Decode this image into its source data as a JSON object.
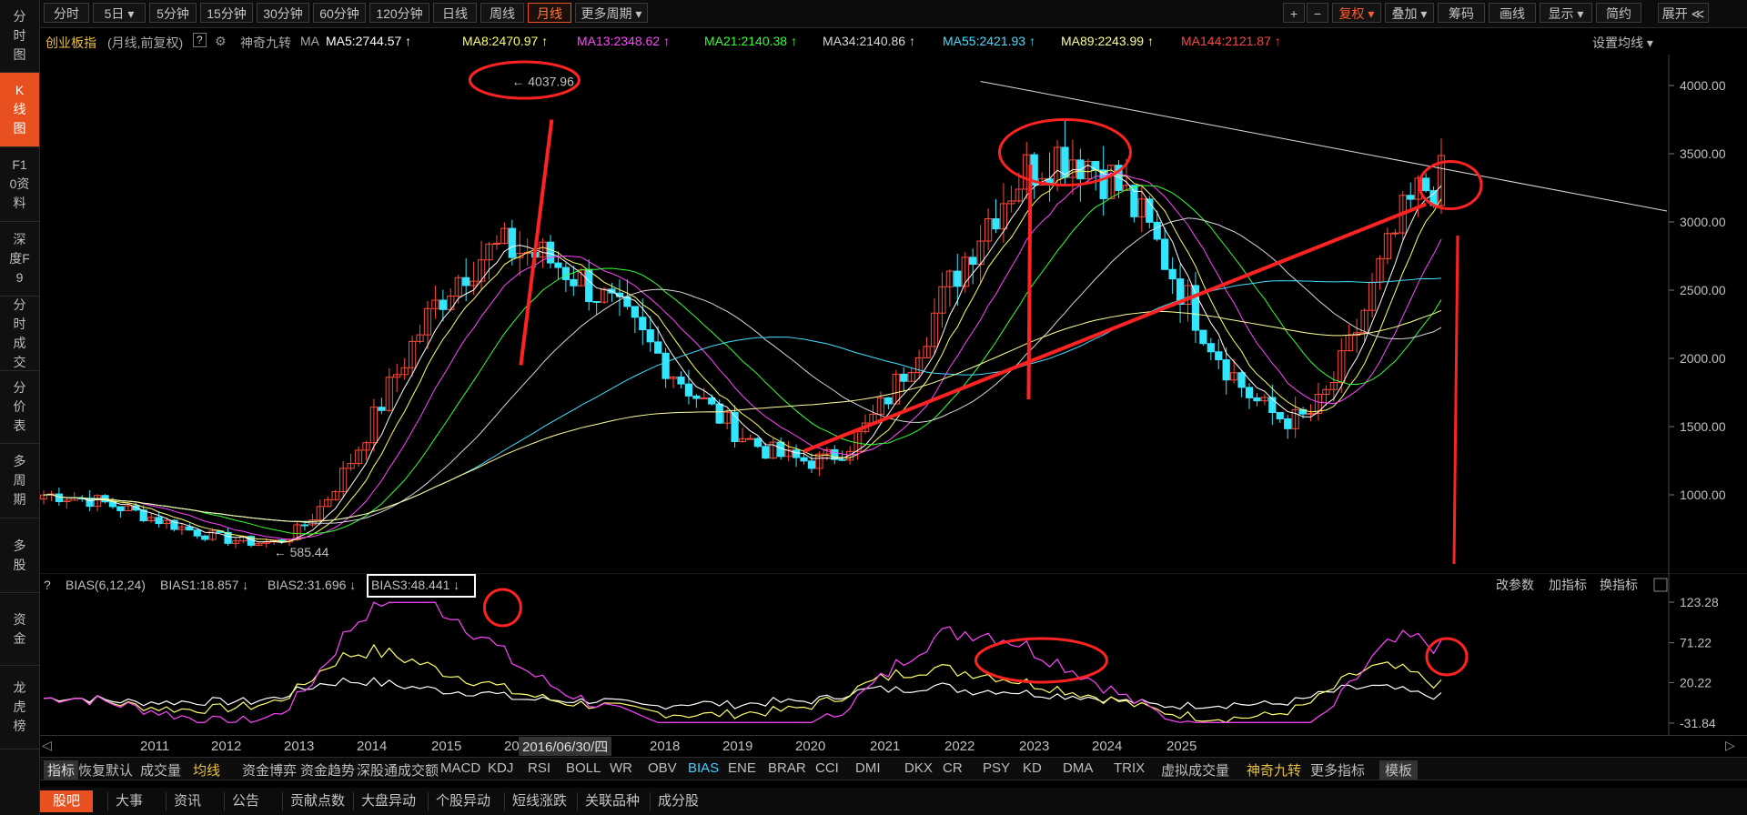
{
  "sidebar": [
    {
      "label": "分时图",
      "active": false
    },
    {
      "label": "K线图",
      "active": true
    },
    {
      "label": "F10资料",
      "active": false
    },
    {
      "label": "深度F9",
      "active": false
    },
    {
      "label": "分时成交",
      "active": false
    },
    {
      "label": "分价表",
      "active": false
    },
    {
      "label": "多周期",
      "active": false
    },
    {
      "label": "多股",
      "active": false
    },
    {
      "label": "资金",
      "active": false
    },
    {
      "label": "龙虎榜",
      "active": false
    }
  ],
  "toolbar": {
    "left": [
      "分时",
      "5日 ▾",
      "5分钟",
      "15分钟",
      "30分钟",
      "60分钟",
      "120分钟",
      "日线",
      "周线",
      "月线",
      "更多周期 ▾"
    ],
    "active": "月线",
    "right": [
      "+",
      "−",
      "复权 ▾",
      "叠加 ▾",
      "筹码",
      "画线",
      "显示 ▾",
      "简约",
      "展开 ≪"
    ]
  },
  "infobar": {
    "name": "创业板指",
    "mode": "(月线,前复权)",
    "help": "?",
    "plugin": "神奇九转",
    "ma_label": "MA",
    "ma_items": [
      {
        "text": "MA5:2744.57",
        "color": "#ffffff"
      },
      {
        "text": "MA8:2470.97",
        "color": "#ffff66"
      },
      {
        "text": "MA13:2348.62",
        "color": "#ff44ff"
      },
      {
        "text": "MA21:2140.38",
        "color": "#33ff33"
      },
      {
        "text": "MA34:2140.86",
        "color": "#d8d8d8"
      },
      {
        "text": "MA55:2421.93",
        "color": "#44ddff"
      },
      {
        "text": "MA89:2243.99",
        "color": "#ffff99"
      },
      {
        "text": "MA144:2121.87",
        "color": "#ff4444"
      }
    ],
    "settings": "设置均线 ▾"
  },
  "chart_data": {
    "type": "candlestick",
    "period": "monthly",
    "y_ticks": [
      4000,
      3500,
      3000,
      2500,
      2000,
      1500,
      1000
    ],
    "y_tick_labels": [
      "4000.00",
      "3500.00",
      "3000.00",
      "2500.00",
      "2000.00",
      "1500.00",
      "1000.00"
    ],
    "x_tick_labels": [
      "2011",
      "2012",
      "2013",
      "2014",
      "2015",
      "2016",
      "2018",
      "2019",
      "2020",
      "2021",
      "2022",
      "2023",
      "2024",
      "2025"
    ],
    "x_cursor_label": "2016/06/30/四",
    "annotations": {
      "high": "4037.96",
      "low": "585.44"
    },
    "key_points": [
      {
        "date": "2010-06",
        "close": 1000
      },
      {
        "date": "2012-11",
        "low": 585.44,
        "close": 650
      },
      {
        "date": "2015-06",
        "high": 4037.96,
        "close": 2800
      },
      {
        "date": "2018-10",
        "close": 1250
      },
      {
        "date": "2021-07",
        "close": 3500
      },
      {
        "date": "2024-01",
        "close": 1550
      },
      {
        "date": "2025-08",
        "close": 3300
      }
    ],
    "bias": {
      "title": "BIAS(6,12,24)",
      "series": [
        {
          "name": "BIAS1",
          "value": "BIAS1:18.857",
          "color": "#ffffff"
        },
        {
          "name": "BIAS2",
          "value": "BIAS2:31.696",
          "color": "#ffff66"
        },
        {
          "name": "BIAS3",
          "value": "BIAS3:48.441",
          "color": "#ff44ff"
        }
      ],
      "y_tick_labels": [
        "123.28",
        "71.22",
        "20.22",
        "-31.84"
      ],
      "y_ticks": [
        123.28,
        71.22,
        20.22,
        -31.84
      ],
      "actions": [
        "改参数",
        "加指标",
        "换指标"
      ]
    }
  },
  "indicators": {
    "items": [
      "指标",
      "恢复默认",
      "成交量",
      "均线",
      "资金博弈",
      "资金趋势",
      "深股通成交额",
      "MACD",
      "KDJ",
      "RSI",
      "BOLL",
      "WR",
      "OBV",
      "BIAS",
      "ENE",
      "BRAR",
      "CCI",
      "DMI",
      "DKX",
      "CR",
      "PSY",
      "KD",
      "DMA",
      "TRIX",
      "虚拟成交量",
      "神奇九转",
      "更多指标",
      "模板"
    ],
    "active": "BIAS"
  },
  "bottom": {
    "items": [
      "股吧",
      "大事",
      "资讯",
      "公告",
      "贡献点数",
      "大盘异动",
      "个股异动",
      "短线涨跌",
      "关联品种",
      "成分股"
    ]
  },
  "colors": {
    "up": "#ff4a3a",
    "down": "#33e6ff",
    "accent": "#e8511f",
    "annot": "#ff2222"
  }
}
